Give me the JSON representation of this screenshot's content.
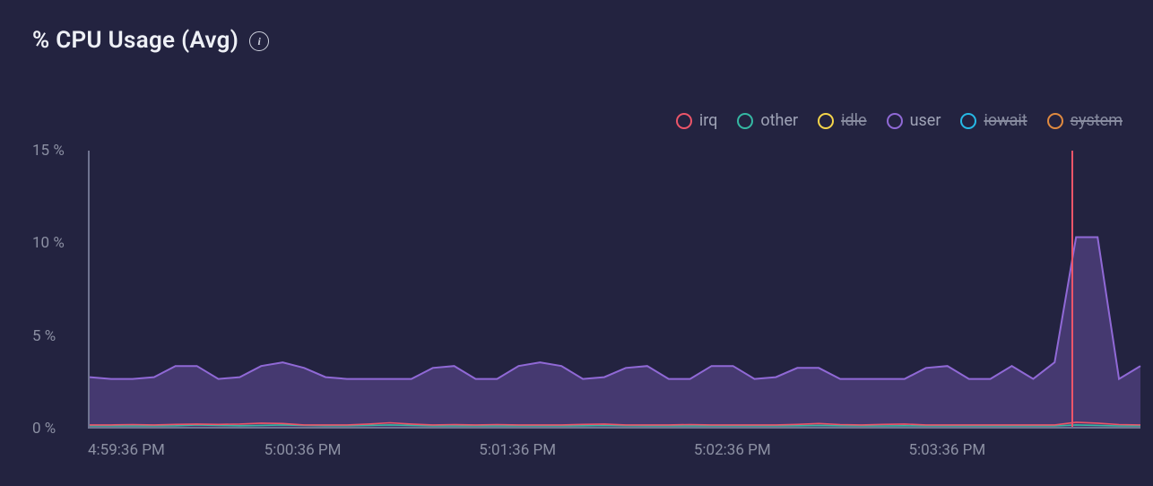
{
  "title": "% CPU Usage (Avg)",
  "info_tooltip": "info",
  "legend": [
    {
      "key": "irq",
      "label": "irq",
      "color": "#ec5569",
      "disabled": false
    },
    {
      "key": "other",
      "label": "other",
      "color": "#35b8a3",
      "disabled": false
    },
    {
      "key": "idle",
      "label": "idle",
      "color": "#f5d54a",
      "disabled": true
    },
    {
      "key": "user",
      "label": "user",
      "color": "#9069d6",
      "disabled": false
    },
    {
      "key": "iowait",
      "label": "iowait",
      "color": "#26b9e6",
      "disabled": true
    },
    {
      "key": "system",
      "label": "system",
      "color": "#e08a3f",
      "disabled": true
    }
  ],
  "y_ticks": [
    "0 %",
    "5 %",
    "10 %",
    "15 %"
  ],
  "x_ticks": [
    "4:59:36 PM",
    "5:00:36 PM",
    "5:01:36 PM",
    "5:02:36 PM",
    "5:03:36 PM"
  ],
  "cursor_x_frac": 0.934,
  "chart_data": {
    "type": "area",
    "title": "% CPU Usage (Avg)",
    "ylabel": "%",
    "ylim": [
      0,
      15
    ],
    "grid": false,
    "legend_position": "top-right",
    "categories": [
      "4:59:36 PM",
      "4:59:42 PM",
      "4:59:48 PM",
      "4:59:54 PM",
      "5:00:00 PM",
      "5:00:06 PM",
      "5:00:12 PM",
      "5:00:18 PM",
      "5:00:24 PM",
      "5:00:30 PM",
      "5:00:36 PM",
      "5:00:42 PM",
      "5:00:48 PM",
      "5:00:54 PM",
      "5:01:00 PM",
      "5:01:06 PM",
      "5:01:12 PM",
      "5:01:18 PM",
      "5:01:24 PM",
      "5:01:30 PM",
      "5:01:36 PM",
      "5:01:42 PM",
      "5:01:48 PM",
      "5:01:54 PM",
      "5:02:00 PM",
      "5:02:06 PM",
      "5:02:12 PM",
      "5:02:18 PM",
      "5:02:24 PM",
      "5:02:30 PM",
      "5:02:36 PM",
      "5:02:42 PM",
      "5:02:48 PM",
      "5:02:54 PM",
      "5:03:00 PM",
      "5:03:06 PM",
      "5:03:12 PM",
      "5:03:18 PM",
      "5:03:24 PM",
      "5:03:30 PM",
      "5:03:36 PM",
      "5:03:42 PM",
      "5:03:48 PM",
      "5:03:54 PM",
      "5:04:00 PM",
      "5:04:06 PM",
      "5:04:12 PM",
      "5:04:18 PM",
      "5:04:24 PM",
      "5:04:30 PM"
    ],
    "series": [
      {
        "name": "user",
        "color": "#9069d6",
        "values": [
          2.7,
          2.6,
          2.6,
          2.7,
          3.3,
          3.3,
          2.6,
          2.7,
          3.3,
          3.5,
          3.2,
          2.7,
          2.6,
          2.6,
          2.6,
          2.6,
          3.2,
          3.3,
          2.6,
          2.6,
          3.3,
          3.5,
          3.3,
          2.6,
          2.7,
          3.2,
          3.3,
          2.6,
          2.6,
          3.3,
          3.3,
          2.6,
          2.7,
          3.2,
          3.2,
          2.6,
          2.6,
          2.6,
          2.6,
          3.2,
          3.3,
          2.6,
          2.6,
          3.3,
          2.6,
          3.5,
          10.3,
          10.3,
          2.6,
          3.3
        ]
      },
      {
        "name": "irq",
        "color": "#ec5569",
        "values": [
          0.1,
          0.1,
          0.12,
          0.1,
          0.13,
          0.15,
          0.13,
          0.15,
          0.2,
          0.18,
          0.1,
          0.1,
          0.1,
          0.15,
          0.22,
          0.15,
          0.1,
          0.12,
          0.1,
          0.12,
          0.1,
          0.1,
          0.1,
          0.13,
          0.15,
          0.1,
          0.1,
          0.1,
          0.12,
          0.1,
          0.1,
          0.1,
          0.1,
          0.13,
          0.18,
          0.12,
          0.1,
          0.13,
          0.15,
          0.1,
          0.1,
          0.1,
          0.1,
          0.1,
          0.1,
          0.1,
          0.25,
          0.2,
          0.12,
          0.1
        ]
      },
      {
        "name": "other",
        "color": "#35b8a3",
        "values": [
          0.05,
          0.05,
          0.05,
          0.05,
          0.06,
          0.1,
          0.08,
          0.06,
          0.08,
          0.1,
          0.08,
          0.06,
          0.06,
          0.08,
          0.1,
          0.08,
          0.05,
          0.05,
          0.05,
          0.05,
          0.05,
          0.05,
          0.05,
          0.06,
          0.08,
          0.06,
          0.05,
          0.05,
          0.05,
          0.05,
          0.05,
          0.05,
          0.05,
          0.06,
          0.08,
          0.06,
          0.05,
          0.05,
          0.06,
          0.05,
          0.05,
          0.05,
          0.05,
          0.05,
          0.05,
          0.05,
          0.1,
          0.08,
          0.05,
          0.05
        ]
      }
    ]
  }
}
